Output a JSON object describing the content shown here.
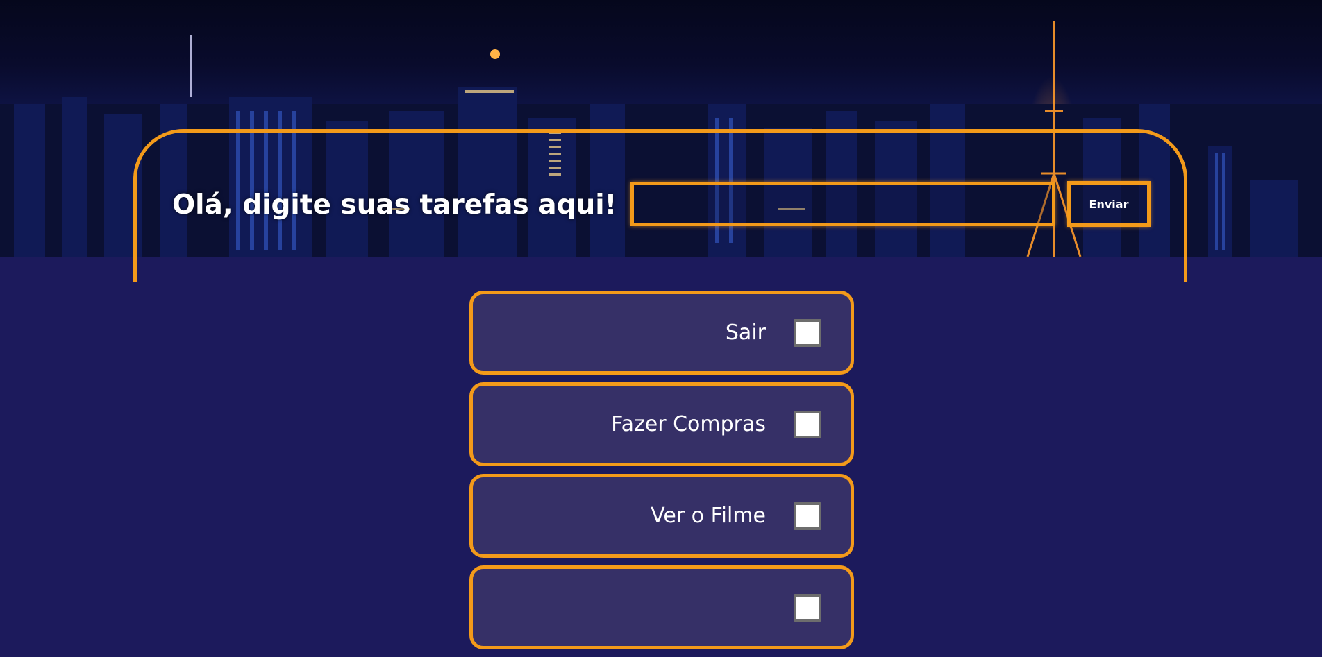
{
  "header": {
    "title": "Olá, digite suas tarefas aqui!",
    "input_value": "",
    "input_placeholder": "",
    "submit_label": "Enviar"
  },
  "tasks": [
    {
      "label": "Sair",
      "checked": false
    },
    {
      "label": "Fazer Compras",
      "checked": false
    },
    {
      "label": "Ver o Filme",
      "checked": false
    },
    {
      "label": "",
      "checked": false
    }
  ],
  "colors": {
    "accent": "#f39a1a",
    "page_background": "#1c1a5c",
    "card_background": "#363067",
    "text": "#ffffff"
  }
}
